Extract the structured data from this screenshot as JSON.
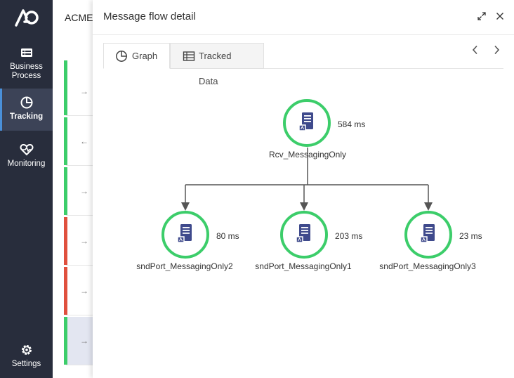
{
  "app": {
    "company": "ACME"
  },
  "sidebar": {
    "items": [
      {
        "label": "Business\nProcess",
        "icon": "business-process-icon"
      },
      {
        "label": "Tracking",
        "icon": "tracking-icon",
        "active": true
      },
      {
        "label": "Monitoring",
        "icon": "monitoring-icon"
      },
      {
        "label": "Settings",
        "icon": "gear-icon"
      }
    ]
  },
  "background_rows": [
    {
      "status": "success",
      "direction": "→"
    },
    {
      "status": "success",
      "direction": "←"
    },
    {
      "status": "success",
      "direction": "→"
    },
    {
      "status": "error",
      "direction": "→"
    },
    {
      "status": "error",
      "direction": "→"
    },
    {
      "status": "success",
      "direction": "→",
      "selected": true
    }
  ],
  "panel": {
    "title": "Message flow detail",
    "tabs": [
      {
        "label": "Graph",
        "icon": "pie-chart-icon",
        "active": true
      },
      {
        "label": "Tracked Data",
        "icon": "table-icon"
      }
    ]
  },
  "graph": {
    "nodes": {
      "root": {
        "name": "Rcv_MessagingOnly",
        "duration": "584 ms"
      },
      "left": {
        "name": "sndPort_MessagingOnly2",
        "duration": "80 ms"
      },
      "middle": {
        "name": "sndPort_MessagingOnly1",
        "duration": "203 ms"
      },
      "right": {
        "name": "sndPort_MessagingOnly3",
        "duration": "23 ms"
      }
    }
  },
  "colors": {
    "sidebar_bg": "#282d3c",
    "success": "#3ccd6a",
    "error": "#e0503e",
    "node_icon": "#3f4a8c"
  }
}
